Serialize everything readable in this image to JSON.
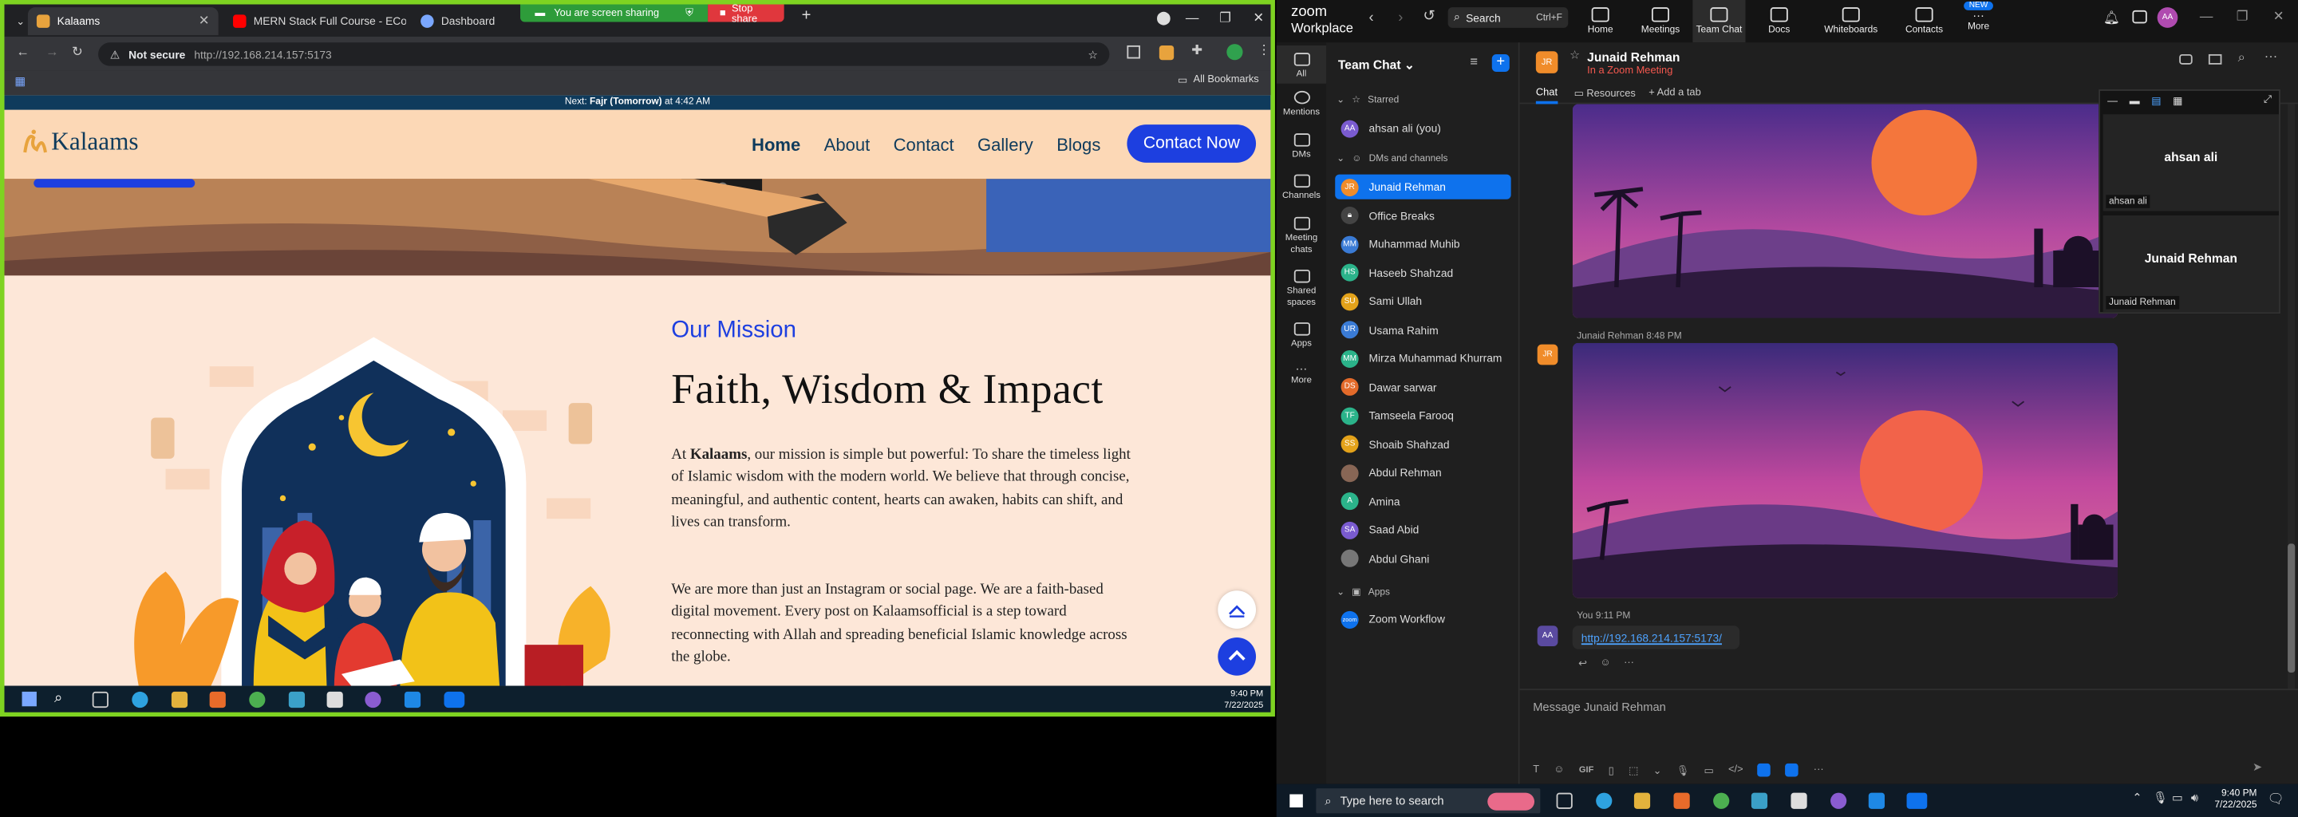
{
  "browser": {
    "tabs": [
      {
        "label": "Kalaams",
        "color": "#e8a33d"
      },
      {
        "label": "MERN Stack Full Course - ECom",
        "color": "#ff0000"
      },
      {
        "label": "Dashboard",
        "color": "#7aa7ff"
      }
    ],
    "sharing_label": "You are screen sharing",
    "stop_share_label": "Stop share",
    "not_secure": "Not secure",
    "url": "http://192.168.214.157:5173",
    "all_bookmarks": "All Bookmarks"
  },
  "site": {
    "prayer_banner_prefix": "Next: ",
    "prayer_name": "Fajr (Tomorrow)",
    "prayer_suffix": " at 4:42 AM",
    "logo": "Kalaams",
    "nav": [
      "Home",
      "About",
      "Contact",
      "Gallery",
      "Blogs"
    ],
    "contact_button": "Contact Now",
    "mission_eyebrow": "Our Mission",
    "mission_title": "Faith, Wisdom & Impact",
    "para1_prefix": "At ",
    "para1_brand": "Kalaams",
    "para1_rest": ", our mission is simple but powerful: To share the timeless light of Islamic wisdom with the modern world. We believe that through concise, meaningful, and authentic content, hearts can awaken, habits can shift, and lives can transform.",
    "para2": "We are more than just an Instagram or social page. We are a faith-based digital movement. Every post on Kalaamsofficial is a step toward reconnecting with Allah and spreading beneficial Islamic knowledge across the globe."
  },
  "shared_taskbar": {
    "time": "9:40 PM",
    "date": "7/22/2025"
  },
  "zoom": {
    "brand_top": "zoom",
    "brand_bottom": "Workplace",
    "search_label": "Search",
    "search_shortcut": "Ctrl+F",
    "top_tabs": [
      "Home",
      "Meetings",
      "Team Chat",
      "Docs",
      "Whiteboards",
      "Contacts",
      "More"
    ],
    "new_badge": "NEW",
    "avatar_initials": "AA",
    "rail": [
      "All",
      "Mentions",
      "DMs",
      "Channels",
      "Meeting chats",
      "Shared spaces",
      "Apps",
      "More"
    ],
    "list_title": "Team Chat",
    "starred_label": "Starred",
    "dms_label": "DMs and channels",
    "apps_label": "Apps",
    "starred": [
      {
        "name": "ahsan ali (you)",
        "initials": "AA",
        "color": "#7a5bd0"
      }
    ],
    "contacts": [
      {
        "name": "Junaid Rehman",
        "initials": "JR",
        "color": "#f08c2a",
        "active": true
      },
      {
        "name": "Office Breaks",
        "initials": "",
        "color": "#444"
      },
      {
        "name": "Muhammad Muhib",
        "initials": "MM",
        "color": "#3a7bd5"
      },
      {
        "name": "Haseeb Shahzad",
        "initials": "HS",
        "color": "#2bb38a"
      },
      {
        "name": "Sami Ullah",
        "initials": "SU",
        "color": "#e3a21a"
      },
      {
        "name": "Usama Rahim",
        "initials": "UR",
        "color": "#3a7bd5"
      },
      {
        "name": "Mirza Muhammad Khurram",
        "initials": "MM",
        "color": "#2bb38a"
      },
      {
        "name": "Dawar sarwar",
        "initials": "DS",
        "color": "#e36a2a"
      },
      {
        "name": "Tamseela Farooq",
        "initials": "TF",
        "color": "#2bb38a"
      },
      {
        "name": "Shoaib Shahzad",
        "initials": "SS",
        "color": "#e3a21a"
      },
      {
        "name": "Abdul Rehman",
        "initials": "",
        "color": "#886655"
      },
      {
        "name": "Amina",
        "initials": "A",
        "color": "#2bb38a"
      },
      {
        "name": "Saad Abid",
        "initials": "SA",
        "color": "#7a5bd0"
      },
      {
        "name": "Abdul Ghani",
        "initials": "",
        "color": "#777"
      }
    ],
    "apps": [
      {
        "name": "Zoom Workflow",
        "initials": "zoom",
        "color": "#0e72ed"
      }
    ],
    "chat_name": "Junaid Rehman",
    "chat_status": "In a Zoom Meeting",
    "chat_initials": "JR",
    "chat_tabs": [
      "Chat",
      "Resources",
      "Add a tab"
    ],
    "msg1_meta": "Junaid Rehman 8:48 PM",
    "msg2_meta": "You 9:11 PM",
    "my_initials": "AA",
    "link": "http://192.168.214.157:5173/",
    "composer_placeholder": "Message Junaid Rehman",
    "gif_label": "GIF",
    "video_tiles": [
      {
        "name": "ahsan ali",
        "tag": "ahsan ali"
      },
      {
        "name": "Junaid Rehman",
        "tag": "Junaid Rehman"
      }
    ]
  },
  "windows": {
    "search_placeholder": "Type here to search",
    "time": "9:40 PM",
    "date": "7/22/2025"
  }
}
